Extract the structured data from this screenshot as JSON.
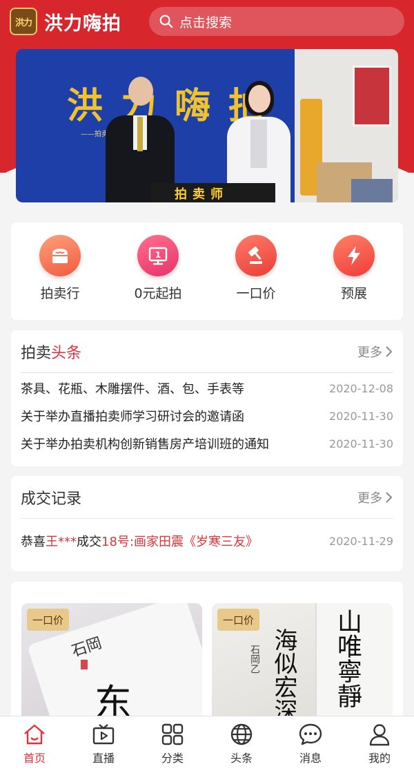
{
  "header": {
    "app_title": "洪力嗨拍",
    "logo_text": "洪力",
    "search_placeholder": "点击搜索"
  },
  "banner": {
    "calligraphy": "洪力嗨拍",
    "subtitle": "——拍卖行业的专业直播拍",
    "podium_text": "拍卖师"
  },
  "nav": [
    {
      "label": "拍卖行",
      "icon": "auction-house-icon"
    },
    {
      "label": "0元起拍",
      "icon": "zero-start-icon"
    },
    {
      "label": "一口价",
      "icon": "gavel-icon"
    },
    {
      "label": "预展",
      "icon": "lightning-icon"
    }
  ],
  "news": {
    "title_plain": "拍卖",
    "title_highlight": "头条",
    "more": "更多",
    "items": [
      {
        "title": "茶具、花瓶、木雕摆件、酒、包、手表等",
        "date": "2020-12-08"
      },
      {
        "title": "关于举办直播拍卖师学习研讨会的邀请函",
        "date": "2020-11-30"
      },
      {
        "title": "关于举办拍卖机构创新销售房产培训班的通知",
        "date": "2020-11-30"
      }
    ]
  },
  "deals": {
    "title": "成交记录",
    "more": "更多",
    "items": [
      {
        "prefix": "恭喜",
        "name": "王***",
        "mid": "成交",
        "lot": "18号:画家田震《岁寒三友》",
        "date": "2020-11-29"
      }
    ]
  },
  "goods": [
    {
      "tag": "一口价",
      "ink_main": "东",
      "ink_side": "石岡"
    },
    {
      "tag": "一口价",
      "col1": "海似宏深",
      "col2": "山唯寧靜",
      "seal": "石岡乙"
    }
  ],
  "tabbar": [
    {
      "label": "首页",
      "icon": "home-icon",
      "active": true
    },
    {
      "label": "直播",
      "icon": "tv-icon",
      "active": false
    },
    {
      "label": "分类",
      "icon": "grid-icon",
      "active": false
    },
    {
      "label": "头条",
      "icon": "globe-icon",
      "active": false
    },
    {
      "label": "消息",
      "icon": "message-icon",
      "active": false
    },
    {
      "label": "我的",
      "icon": "user-icon",
      "active": false
    }
  ],
  "colors": {
    "brand_red": "#d8262d",
    "highlight_red": "#e0333a",
    "tag_gold": "#e8c98a"
  }
}
